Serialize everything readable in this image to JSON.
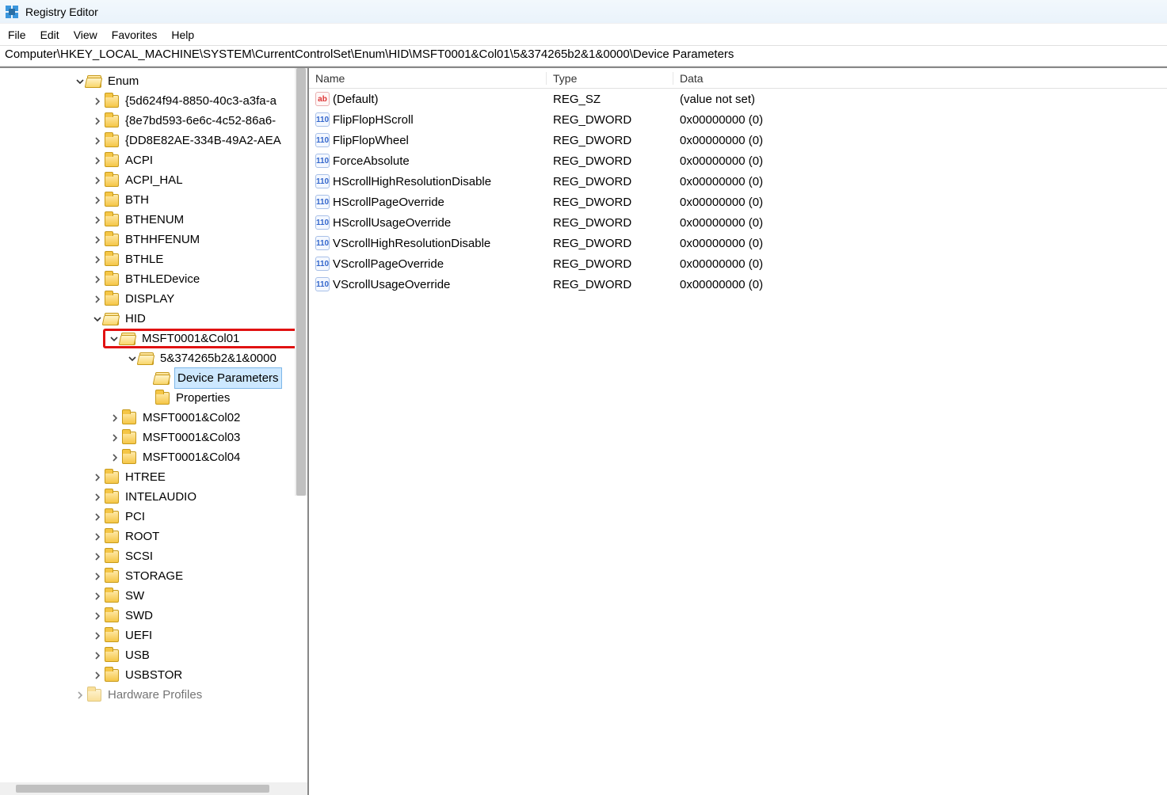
{
  "window": {
    "title": "Registry Editor"
  },
  "menu": {
    "items": [
      "File",
      "Edit",
      "View",
      "Favorites",
      "Help"
    ]
  },
  "addressbar": "Computer\\HKEY_LOCAL_MACHINE\\SYSTEM\\CurrentControlSet\\Enum\\HID\\MSFT0001&Col01\\5&374265b2&1&0000\\Device Parameters",
  "tree": {
    "enum": "Enum",
    "guid1": "{5d624f94-8850-40c3-a3fa-a",
    "guid2": "{8e7bd593-6e6c-4c52-86a6-",
    "guid3": "{DD8E82AE-334B-49A2-AEA",
    "acpi": "ACPI",
    "acpi_hal": "ACPI_HAL",
    "bth": "BTH",
    "bthenum": "BTHENUM",
    "bthhfenum": "BTHHFENUM",
    "bthle": "BTHLE",
    "bthledevice": "BTHLEDevice",
    "display": "DISPLAY",
    "hid": "HID",
    "msft_col01": "MSFT0001&Col01",
    "device_instance": "5&374265b2&1&0000",
    "device_parameters": "Device Parameters",
    "properties": "Properties",
    "msft_col02": "MSFT0001&Col02",
    "msft_col03": "MSFT0001&Col03",
    "msft_col04": "MSFT0001&Col04",
    "htree": "HTREE",
    "intelaudio": "INTELAUDIO",
    "pci": "PCI",
    "root": "ROOT",
    "scsi": "SCSI",
    "storage": "STORAGE",
    "sw": "SW",
    "swd": "SWD",
    "uefi": "UEFI",
    "usb": "USB",
    "usbstor": "USBSTOR",
    "hwprofiles": "Hardware Profiles"
  },
  "list": {
    "headers": {
      "name": "Name",
      "type": "Type",
      "data": "Data"
    },
    "rows": [
      {
        "icon": "str",
        "name": "(Default)",
        "type": "REG_SZ",
        "data": "(value not set)"
      },
      {
        "icon": "num",
        "name": "FlipFlopHScroll",
        "type": "REG_DWORD",
        "data": "0x00000000 (0)"
      },
      {
        "icon": "num",
        "name": "FlipFlopWheel",
        "type": "REG_DWORD",
        "data": "0x00000000 (0)"
      },
      {
        "icon": "num",
        "name": "ForceAbsolute",
        "type": "REG_DWORD",
        "data": "0x00000000 (0)"
      },
      {
        "icon": "num",
        "name": "HScrollHighResolutionDisable",
        "type": "REG_DWORD",
        "data": "0x00000000 (0)"
      },
      {
        "icon": "num",
        "name": "HScrollPageOverride",
        "type": "REG_DWORD",
        "data": "0x00000000 (0)"
      },
      {
        "icon": "num",
        "name": "HScrollUsageOverride",
        "type": "REG_DWORD",
        "data": "0x00000000 (0)"
      },
      {
        "icon": "num",
        "name": "VScrollHighResolutionDisable",
        "type": "REG_DWORD",
        "data": "0x00000000 (0)"
      },
      {
        "icon": "num",
        "name": "VScrollPageOverride",
        "type": "REG_DWORD",
        "data": "0x00000000 (0)"
      },
      {
        "icon": "num",
        "name": "VScrollUsageOverride",
        "type": "REG_DWORD",
        "data": "0x00000000 (0)"
      }
    ]
  }
}
